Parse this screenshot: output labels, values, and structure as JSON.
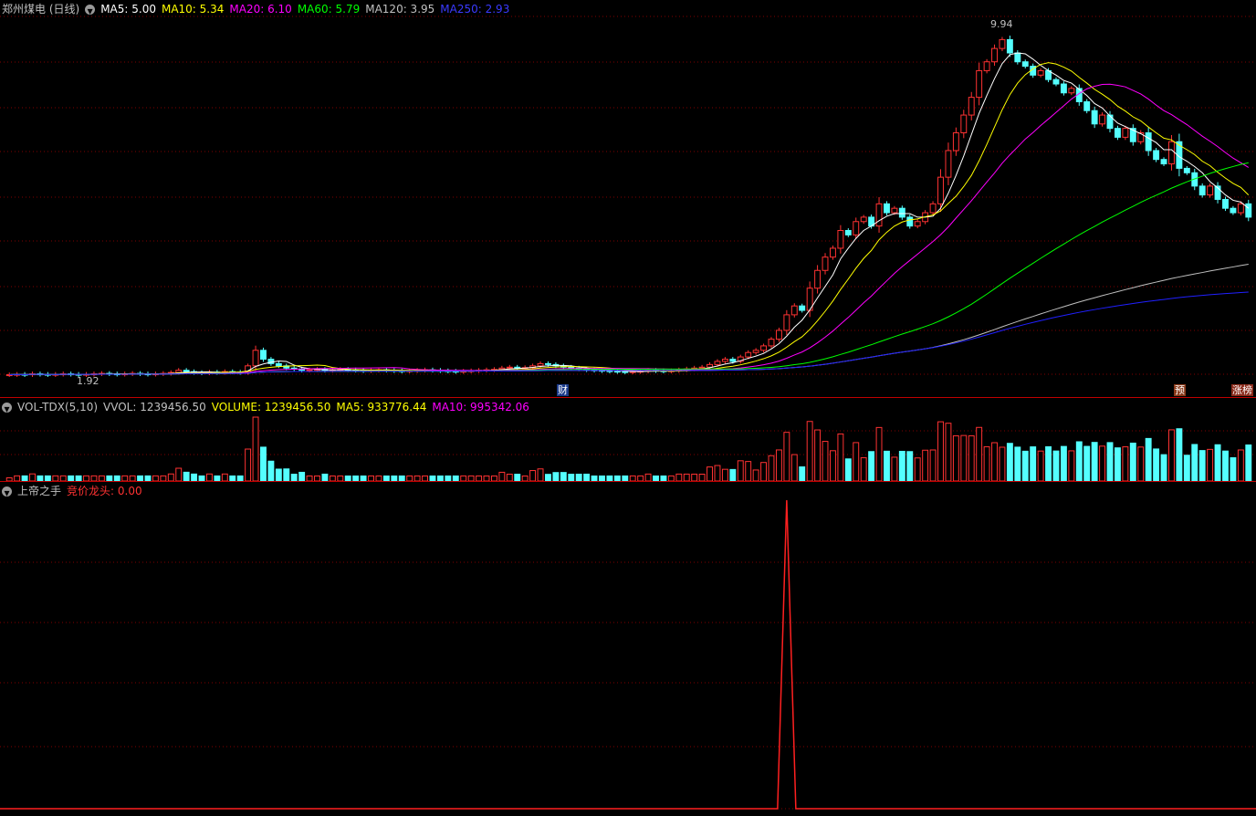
{
  "price_pane": {
    "title": "郑州煤电 (日线)",
    "ma": [
      {
        "label": "MA5: 5.00",
        "color": "#ffffff"
      },
      {
        "label": "MA10: 5.34",
        "color": "#ffff00"
      },
      {
        "label": "MA20: 6.10",
        "color": "#ff00ff"
      },
      {
        "label": "MA60: 5.79",
        "color": "#00ff00"
      },
      {
        "label": "MA120: 3.95",
        "color": "#c0c0c0"
      },
      {
        "label": "MA250: 2.93",
        "color": "#0000ff"
      }
    ],
    "high_label": "9.94",
    "low_label": "1.92",
    "badges": {
      "cai": "财",
      "yu": "预",
      "zhangbang": "涨榜"
    }
  },
  "volume_pane": {
    "title": "VOL-TDX(5,10)",
    "vvol": "VVOL: 1239456.50",
    "volume": "VOLUME: 1239456.50",
    "ma5": "MA5: 933776.44",
    "ma10": "MA10: 995342.06"
  },
  "indicator_pane": {
    "title": "上帝之手",
    "value": "竞价龙头: 0.00"
  },
  "colors": {
    "up": "#ff3232",
    "down": "#54ffff",
    "grid": "#800000",
    "separator": "#c00000",
    "indicator_line": "#ff2020"
  },
  "chart_data": {
    "type": "candlestick",
    "price_range": [
      1.92,
      9.94
    ],
    "closes": [
      1.95,
      1.96,
      1.95,
      1.97,
      1.96,
      1.95,
      1.96,
      1.97,
      1.96,
      1.95,
      1.96,
      1.97,
      1.98,
      1.97,
      1.96,
      1.97,
      1.98,
      1.97,
      1.96,
      1.97,
      1.98,
      2.0,
      2.05,
      2.02,
      2.0,
      1.99,
      2.01,
      2.0,
      2.02,
      2.01,
      2.0,
      2.15,
      2.5,
      2.3,
      2.2,
      2.15,
      2.1,
      2.08,
      2.05,
      2.06,
      2.07,
      2.05,
      2.06,
      2.07,
      2.06,
      2.05,
      2.04,
      2.05,
      2.06,
      2.05,
      2.04,
      2.03,
      2.04,
      2.05,
      2.06,
      2.05,
      2.04,
      2.03,
      2.02,
      2.03,
      2.04,
      2.05,
      2.06,
      2.07,
      2.1,
      2.12,
      2.1,
      2.11,
      2.15,
      2.2,
      2.18,
      2.15,
      2.12,
      2.1,
      2.08,
      2.06,
      2.05,
      2.04,
      2.03,
      2.02,
      2.01,
      2.02,
      2.03,
      2.05,
      2.04,
      2.03,
      2.04,
      2.06,
      2.08,
      2.1,
      2.12,
      2.18,
      2.25,
      2.3,
      2.25,
      2.35,
      2.45,
      2.5,
      2.6,
      2.75,
      2.95,
      3.3,
      3.5,
      3.4,
      3.9,
      4.3,
      4.6,
      4.8,
      5.2,
      5.1,
      5.4,
      5.5,
      5.3,
      5.8,
      5.6,
      5.7,
      5.5,
      5.3,
      5.4,
      5.6,
      5.8,
      6.4,
      7.0,
      7.4,
      7.8,
      8.2,
      8.8,
      9.0,
      9.3,
      9.5,
      9.2,
      9.0,
      8.9,
      8.7,
      8.8,
      8.6,
      8.5,
      8.3,
      8.4,
      8.1,
      7.9,
      7.6,
      7.8,
      7.5,
      7.3,
      7.5,
      7.2,
      7.4,
      7.0,
      6.8,
      6.7,
      7.2,
      6.6,
      6.5,
      6.2,
      6.0,
      6.2,
      5.9,
      5.7,
      5.6,
      5.8,
      5.5
    ]
  }
}
